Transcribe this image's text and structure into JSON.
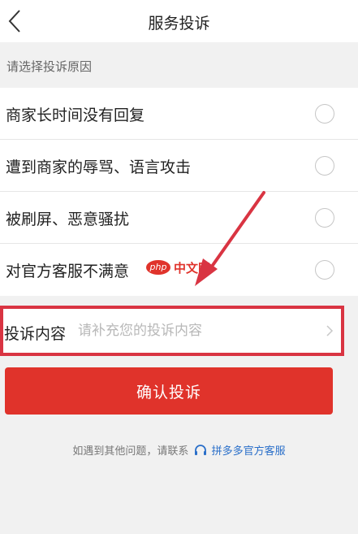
{
  "header": {
    "title": "服务投诉",
    "back_icon": "chevron-left-icon"
  },
  "section_hint": "请选择投诉原因",
  "reasons": [
    {
      "label": "商家长时间没有回复",
      "selected": false
    },
    {
      "label": "遭到商家的辱骂、语言攻击",
      "selected": false
    },
    {
      "label": "被刷屏、恶意骚扰",
      "selected": false
    },
    {
      "label": "对官方客服不满意",
      "selected": false
    }
  ],
  "watermark": {
    "logo": "php",
    "text": "中文网"
  },
  "complaint_content": {
    "label": "投诉内容",
    "value": "",
    "placeholder": "请补充您的投诉内容",
    "icon": "chevron-right-icon"
  },
  "submit_label": "确认投诉",
  "footer": {
    "prefix": "如遇到其他问题，请联系",
    "icon": "headset-icon",
    "link": "拼多多官方客服"
  },
  "colors": {
    "accent": "#e0332b",
    "annotation": "#d93442",
    "link": "#2a6fc9",
    "background": "#f1f1f1"
  }
}
